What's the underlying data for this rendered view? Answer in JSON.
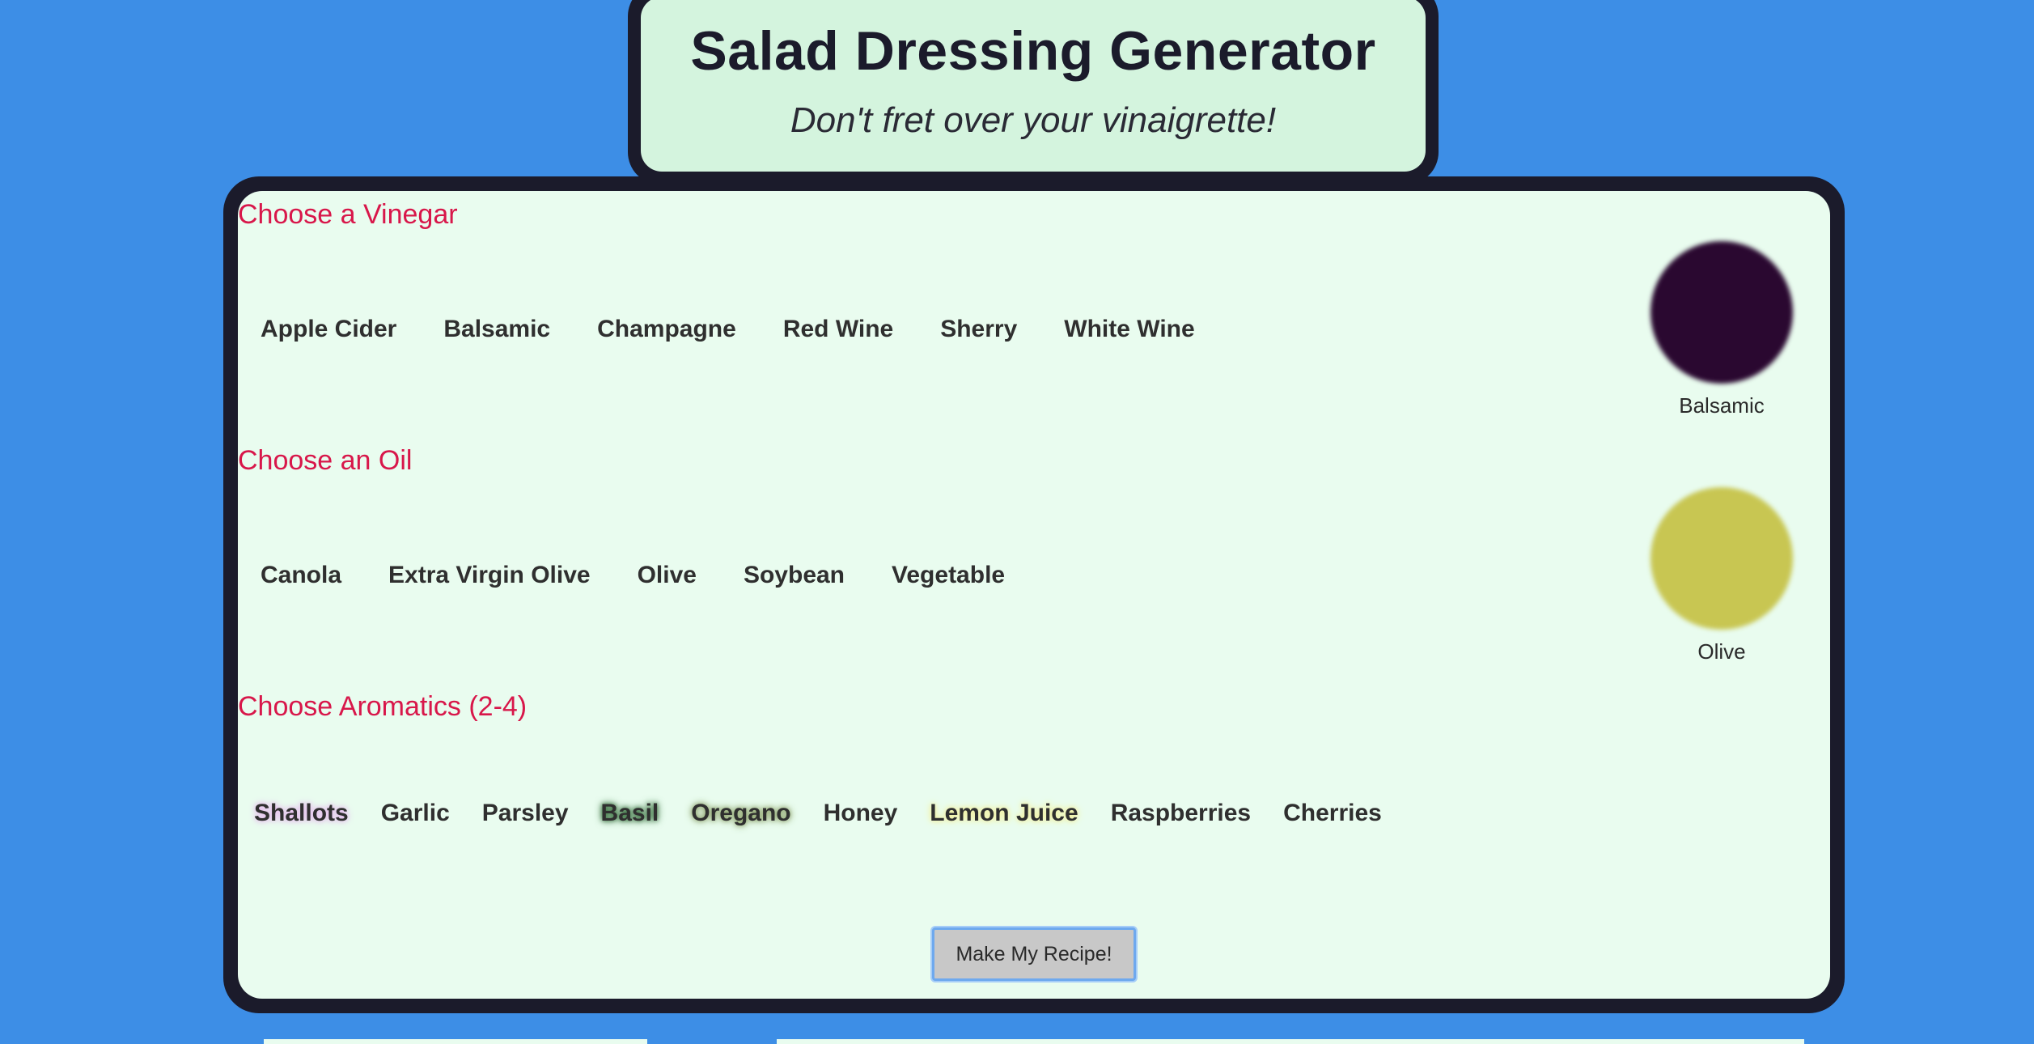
{
  "header": {
    "title": "Salad Dressing Generator",
    "subtitle": "Don't fret over your vinaigrette!"
  },
  "vinegar": {
    "heading": "Choose a Vinegar",
    "options": [
      "Apple Cider",
      "Balsamic",
      "Champagne",
      "Red Wine",
      "Sherry",
      "White Wine"
    ],
    "selected": "Balsamic",
    "swatch_color": "#2a0830"
  },
  "oil": {
    "heading": "Choose an Oil",
    "options": [
      "Canola",
      "Extra Virgin Olive",
      "Olive",
      "Soybean",
      "Vegetable"
    ],
    "selected": "Olive",
    "swatch_color": "#c8c652"
  },
  "aromatics": {
    "heading": "Choose Aromatics (2-4)",
    "options": [
      {
        "label": "Shallots",
        "highlight": "#e6b8ee"
      },
      {
        "label": "Garlic",
        "highlight": ""
      },
      {
        "label": "Parsley",
        "highlight": ""
      },
      {
        "label": "Basil",
        "highlight": "#2f6a35"
      },
      {
        "label": "Oregano",
        "highlight": "#8aa066"
      },
      {
        "label": "Honey",
        "highlight": ""
      },
      {
        "label": "Lemon Juice",
        "highlight": "#f4f19a"
      },
      {
        "label": "Raspberries",
        "highlight": ""
      },
      {
        "label": "Cherries",
        "highlight": ""
      }
    ]
  },
  "submit": {
    "label": "Make My Recipe!"
  },
  "colors": {
    "background": "#3d8ee6",
    "card_border": "#1b1b2b",
    "header_fill": "#d4f4de",
    "panel_fill": "#e9fcef",
    "heading_red": "#d8174a"
  }
}
